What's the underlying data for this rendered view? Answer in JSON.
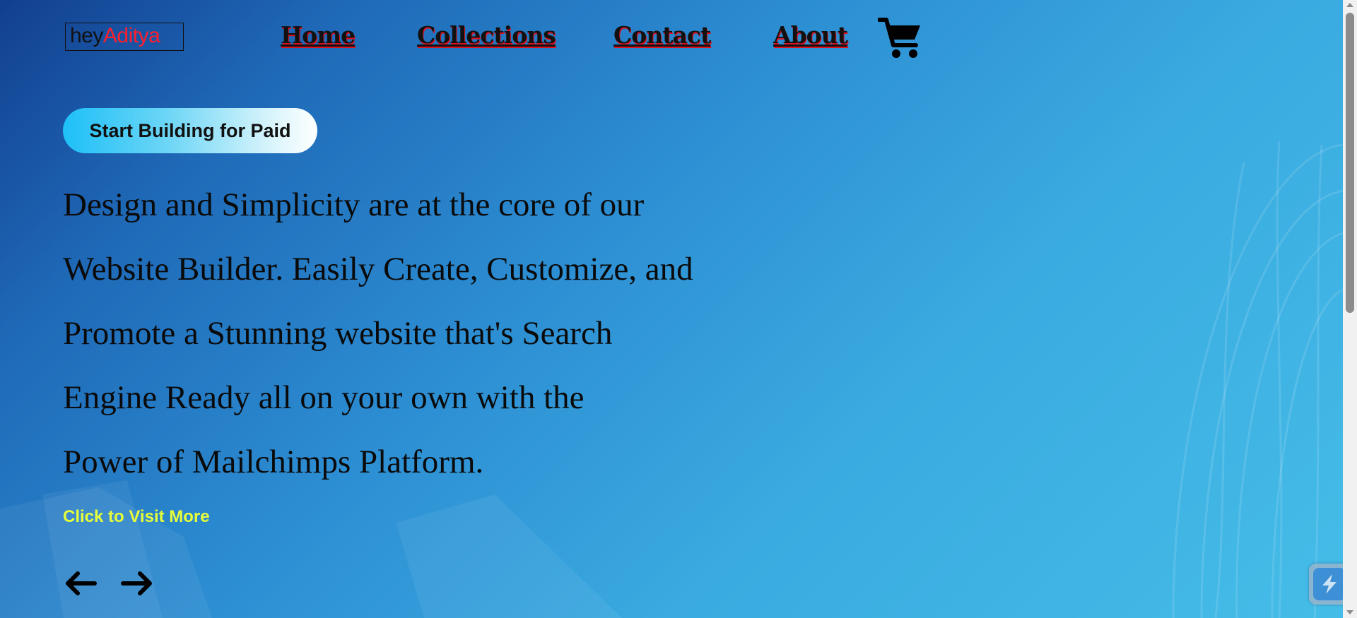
{
  "header": {
    "logo": {
      "prefix": "hey",
      "name": "Aditya"
    },
    "nav": [
      {
        "label": "Home"
      },
      {
        "label": "Collections"
      },
      {
        "label": "Contact"
      },
      {
        "label": "About"
      }
    ],
    "cart_icon": "shopping-cart-icon"
  },
  "hero": {
    "cta_label": "Start Building for Paid",
    "headline_lines": [
      "Design and Simplicity are at the core of our",
      "Website Builder. Easily Create, Customize, and",
      "Promote a Stunning website that's Search",
      "Engine Ready all on your own with the",
      "Power of Mailchimps Platform."
    ],
    "visit_link": "Click to Visit More",
    "prev_icon": "arrow-left-icon",
    "next_icon": "arrow-right-icon"
  },
  "colors": {
    "background_start": "#123f8f",
    "background_end": "#45bde8",
    "logo_accent": "#ff1f2d",
    "nav_shadow": "#e0101e",
    "link": "#e6ff3a"
  },
  "widget_icon": "lightning-icon"
}
